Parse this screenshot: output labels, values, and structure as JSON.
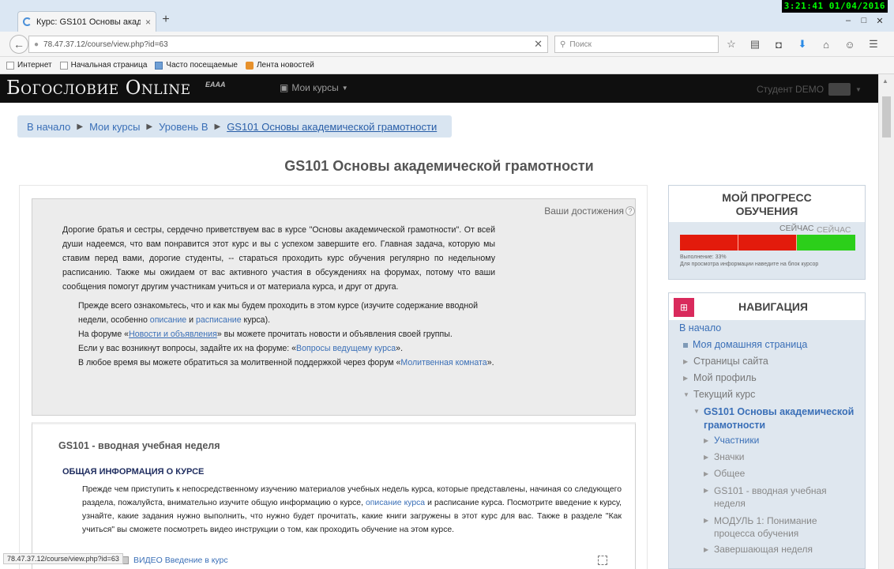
{
  "browser": {
    "tab_title": "Курс: GS101 Основы акаде...",
    "tab_close": "×",
    "new_tab": "+",
    "url": "78.47.37.12/course/view.php?id=63",
    "search_placeholder": "Поиск",
    "clock": "3:21:41  01/04/2016",
    "bookmarks": [
      "Интернет",
      "Начальная страница",
      "Часто посещаемые",
      "Лента новостей"
    ],
    "status_url": "78.47.37.12/course/view.php?id=63"
  },
  "header": {
    "logo": "Богословие Online",
    "logo_mark": "EAAA",
    "mycourses": "Мои курсы",
    "user": "Студент DEMO"
  },
  "breadcrumb": [
    "В начало",
    "Мои курсы",
    "Уровень B",
    "GS101 Основы академической грамотности"
  ],
  "page_title": "GS101 Основы академической грамотности",
  "intro": {
    "achievements": "Ваши достижения",
    "paragraph": "Дорогие братья и сестры, сердечно приветствуем вас в курсе \"Основы академической грамотности\". От всей души надеемся, что вам понравится этот курс и вы с успехом завершите его. Главная задача, которую мы ставим перед вами, дорогие студенты, -- стараться проходить курс обучения регулярно по недельному расписанию. Также мы ожидаем от вас активного участия в обсуждениях на форумах, потому что ваши сообщения помогут другим участникам учиться и от материала курса, и друг от друга.",
    "l1_a": "Прежде всего ознакомьтесь, что и как мы будем проходить в этом курсе (изучите содержание вводной недели, особенно ",
    "l1_link1": "описание",
    "l1_b": " и ",
    "l1_link2": "расписание",
    "l1_c": " курса).",
    "l2_a": "На форуме «",
    "l2_link": "Новости и объявления",
    "l2_b": "» вы можете прочитать новости и объявления своей группы.",
    "l3_a": "Если у вас возникнут вопросы, задайте их на форуме: «",
    "l3_link": "Вопросы ведущему курса",
    "l3_b": "».",
    "l4_a": "В любое время вы можете обратиться за молитвенной поддержкой через форум «",
    "l4_link": "Молитвенная комната",
    "l4_b": "»."
  },
  "week": {
    "title": "GS101 - вводная учебная неделя",
    "subtitle": "ОБЩАЯ ИНФОРМАЦИЯ О КУРСЕ",
    "p_a": "Прежде чем приступить к непосредственному изучению материалов учебных недель курса, которые представлены, начиная со следующего раздела, пожалуйста, внимательно изучите общую информацию о курсе, ",
    "p_link": "описание курса",
    "p_b": " и расписание курса. Посмотрите введение к курсу, узнайте, какие задания нужно выполнить, что нужно будет прочитать, какие книги загружены в этот курс для вас. Также в разделе \"Как учиться\" вы сможете посмотреть видео инструкции о том, как проходить обучение на этом курсе.",
    "video": "ВИДЕО Введение в курс"
  },
  "progress": {
    "title_line1": "МОЙ ПРОГРЕСС",
    "title_line2": "ОБУЧЕНИЯ",
    "now_label": "СЕЙЧАС",
    "now_label2": "СЕЙЧАС",
    "info_line1": "Выполнение: 33%",
    "info_line2": "Для просмотра информации наведите на блок курсор",
    "segments": [
      "done-red",
      "done-red",
      "done-green"
    ]
  },
  "navigation": {
    "title": "НАВИГАЦИЯ",
    "home": "В начало",
    "dashboard": "Моя домашняя страница",
    "site_pages": "Страницы сайта",
    "profile": "Мой профиль",
    "current_course": "Текущий курс",
    "course": "GS101 Основы академической грамотности",
    "participants": "Участники",
    "badges": "Значки",
    "general": "Общее",
    "intro_week": "GS101 - вводная учебная неделя",
    "module1": "МОДУЛЬ 1: Понимание процесса обучения",
    "final_week": "Завершающая неделя"
  },
  "colors": {
    "accent": "#3a6fb7",
    "progress_red": "#e31b0c",
    "progress_green": "#2ccf1a",
    "nav_icon": "#d92a5c"
  }
}
